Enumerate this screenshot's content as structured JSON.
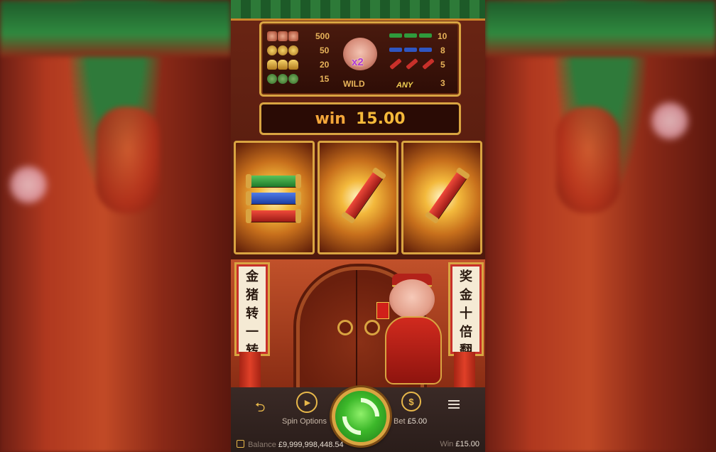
{
  "paytable": {
    "rows": [
      {
        "symbol": "pig-icon",
        "payout": "500"
      },
      {
        "symbol": "coin-icon",
        "payout": "50"
      },
      {
        "symbol": "ingot-icon",
        "payout": "20"
      },
      {
        "symbol": "pouch-icon",
        "payout": "15"
      }
    ],
    "wild_label": "WILD",
    "wild_multiplier": "x2",
    "firecracker_rows": [
      {
        "payout": "10"
      },
      {
        "payout": "8"
      },
      {
        "payout": "5"
      },
      {
        "payout": "3"
      }
    ],
    "any_label": "ANY"
  },
  "win_bar": {
    "label": "win",
    "value": "15.00"
  },
  "reels": [
    {
      "symbols": [
        "green-firecracker",
        "blue-firecracker",
        "red-firecracker"
      ]
    },
    {
      "symbols": [
        "red-firecracker"
      ]
    },
    {
      "symbols": [
        "red-firecracker"
      ]
    }
  ],
  "scrolls": {
    "left": [
      "金",
      "猪",
      "转",
      "一",
      "转"
    ],
    "right": [
      "奖",
      "金",
      "十",
      "倍",
      "翻"
    ]
  },
  "controls": {
    "spin_options_label": "Spin Options",
    "bet_label": "Bet",
    "bet_value": "£5.00"
  },
  "footer": {
    "balance_label": "Balance",
    "balance_value": "£9,999,998,448.54",
    "win_label": "Win",
    "win_value": "£15.00"
  },
  "colors": {
    "gold": "#d9a441",
    "spin_green": "#3cb82a",
    "win_orange": "#f5b93a"
  }
}
